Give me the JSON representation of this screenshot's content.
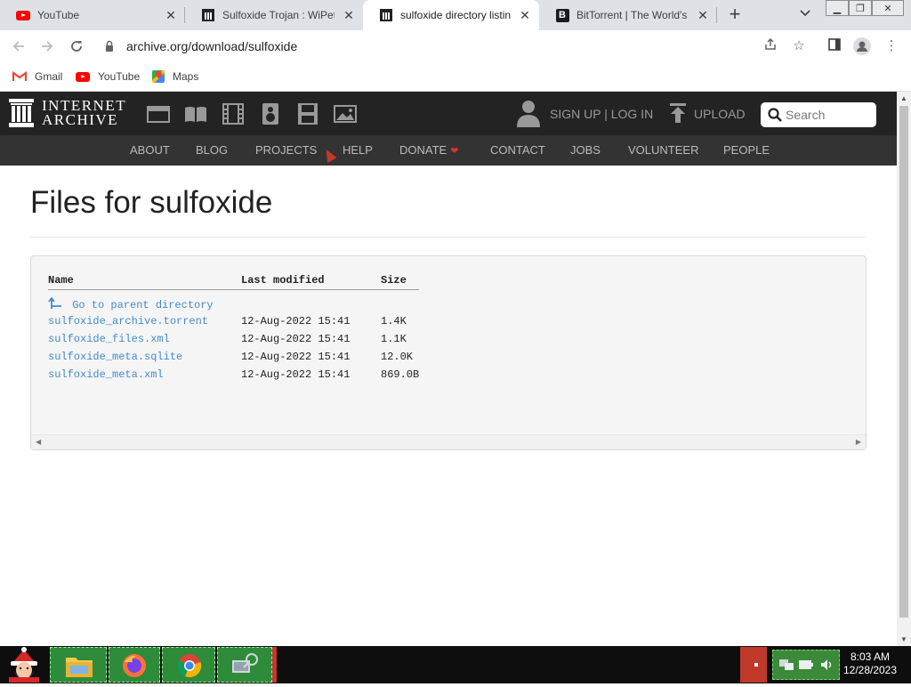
{
  "browser": {
    "tabs": [
      {
        "title": "YouTube",
        "favicon": "youtube-icon",
        "active": false
      },
      {
        "title": "Sulfoxide Trojan : WiPet :",
        "favicon": "internet-archive-icon",
        "active": false
      },
      {
        "title": "sulfoxide directory listing",
        "favicon": "internet-archive-icon",
        "active": true
      },
      {
        "title": "BitTorrent | The World's M",
        "favicon": "bittorrent-icon",
        "active": false
      }
    ],
    "url": "archive.org/download/sulfoxide",
    "bookmarks": [
      {
        "label": "Gmail",
        "icon": "gmail-icon"
      },
      {
        "label": "YouTube",
        "icon": "youtube-icon"
      },
      {
        "label": "Maps",
        "icon": "maps-icon"
      }
    ]
  },
  "ia_header": {
    "logo_line1": "INTERNET",
    "logo_line2": "ARCHIVE",
    "signup": "SIGN UP | LOG IN",
    "upload": "UPLOAD",
    "search_placeholder": "Search",
    "nav": [
      "ABOUT",
      "BLOG",
      "PROJECTS",
      "HELP",
      "DONATE",
      "CONTACT",
      "JOBS",
      "VOLUNTEER",
      "PEOPLE"
    ]
  },
  "page": {
    "title": "Files for sulfoxide",
    "columns": {
      "name": "Name",
      "modified": "Last modified",
      "size": "Size"
    },
    "parent_link": "Go to parent directory",
    "files": [
      {
        "name": "sulfoxide_archive.torrent",
        "modified": "12-Aug-2022 15:41",
        "size": "1.4K"
      },
      {
        "name": "sulfoxide_files.xml",
        "modified": "12-Aug-2022 15:41",
        "size": "1.1K"
      },
      {
        "name": "sulfoxide_meta.sqlite",
        "modified": "12-Aug-2022 15:41",
        "size": "12.0K"
      },
      {
        "name": "sulfoxide_meta.xml",
        "modified": "12-Aug-2022 15:41",
        "size": "869.0B"
      }
    ]
  },
  "taskbar": {
    "time": "8:03 AM",
    "date": "12/28/2023"
  },
  "colors": {
    "ia_dark": "#232323",
    "ia_subnav": "#333333",
    "link": "#428bca",
    "taskbar_green": "#3a8a3a"
  }
}
